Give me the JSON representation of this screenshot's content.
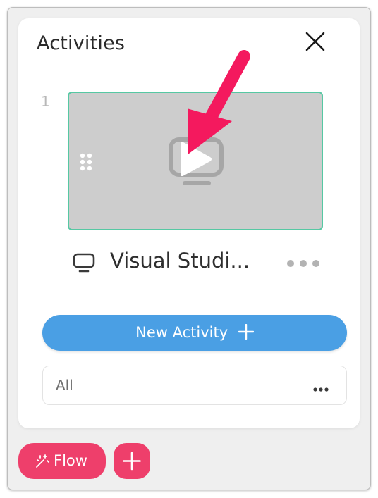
{
  "panel": {
    "title": "Activities",
    "activities": [
      {
        "index": "1",
        "name": "Visual Studi...",
        "type_icon": "monitor-icon"
      }
    ],
    "new_activity_label": "New Activity",
    "filter": {
      "label": "All"
    }
  },
  "footer": {
    "flow_label": "Flow",
    "add_icon": "plus-icon"
  },
  "colors": {
    "accent_blue": "#4a9fe4",
    "accent_pink": "#ee3f6b",
    "selected_border": "#56c8a3",
    "annotation_arrow": "#f4195e"
  }
}
